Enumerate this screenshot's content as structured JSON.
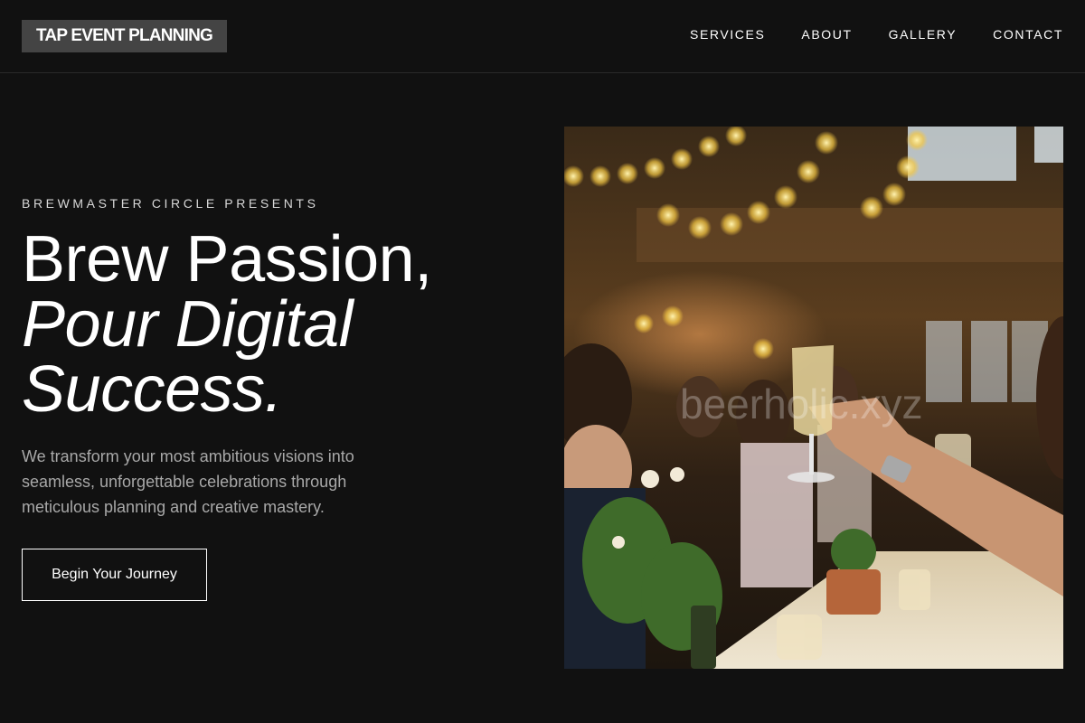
{
  "header": {
    "logo": "TAP EVENT PLANNING",
    "nav": [
      "SERVICES",
      "ABOUT",
      "GALLERY",
      "CONTACT"
    ]
  },
  "hero": {
    "eyebrow": "BREWMASTER CIRCLE PRESENTS",
    "headline_line1": "Brew Passion,",
    "headline_line2": "Pour Digital",
    "headline_line3": "Success.",
    "description": "We transform your most ambitious visions into seamless, unforgettable celebrations through meticulous planning and creative mastery.",
    "cta_label": "Begin Your Journey",
    "image_watermark": "beerholic.xyz"
  },
  "colors": {
    "background": "#111111",
    "logo_bg": "#444444",
    "text": "#ffffff",
    "muted_text": "#a8a8a8"
  }
}
